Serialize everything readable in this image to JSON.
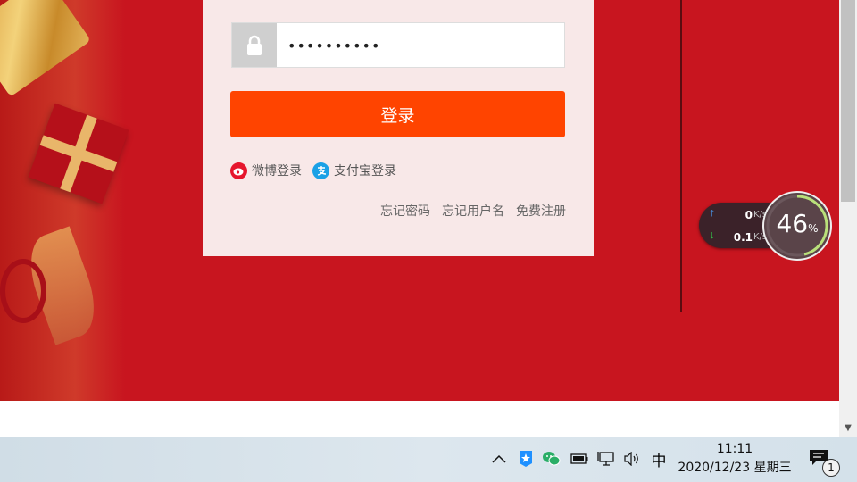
{
  "login": {
    "password_value": "••••••••••",
    "login_button": "登录",
    "alt_logins": [
      {
        "icon": "weibo-icon",
        "label": "微博登录"
      },
      {
        "icon": "alipay-icon",
        "label": "支付宝登录"
      }
    ],
    "links": [
      "忘记密码",
      "忘记用户名",
      "免费注册"
    ]
  },
  "net_widget": {
    "up_value": "0",
    "up_unit": "K/s",
    "down_value": "0.1",
    "down_unit": "K/s",
    "usage_percent": 46,
    "usage_display": "46",
    "usage_unit": "%"
  },
  "taskbar": {
    "ime": "中",
    "time": "11:11",
    "date": "2020/12/23 星期三",
    "notification_count": "1"
  },
  "colors": {
    "banner": "#c8151f",
    "login_button": "#ff4400",
    "panel": "#f8e8e8"
  }
}
